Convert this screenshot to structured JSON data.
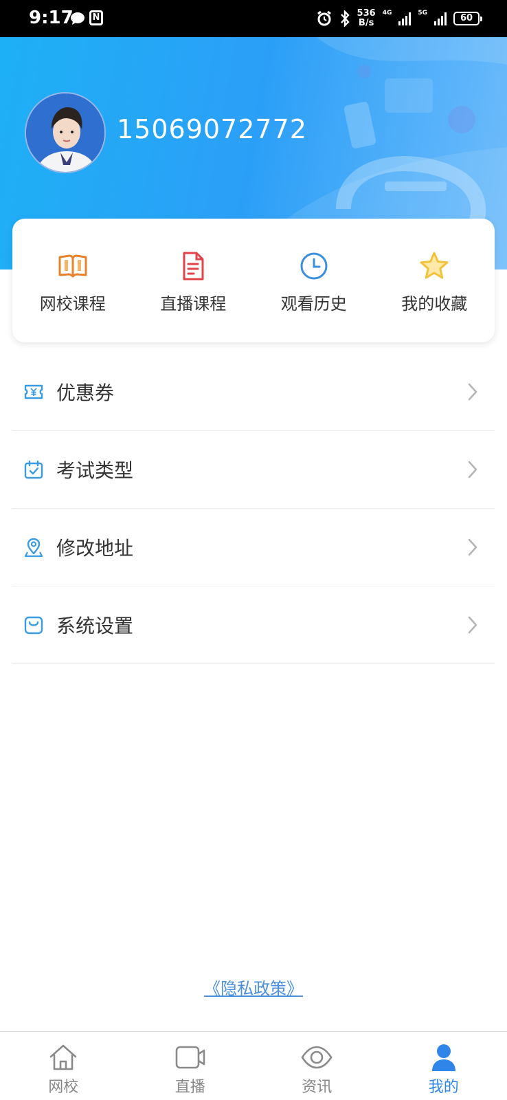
{
  "status_bar": {
    "time": "9:17",
    "speed_value": "536",
    "speed_unit": "B/s",
    "net1": "4G",
    "net2": "5G",
    "battery": "60"
  },
  "profile": {
    "phone": "15069072772",
    "avatar_icon": "avatar-photo"
  },
  "quick_actions": [
    {
      "label": "网校课程",
      "icon": "open-book-icon",
      "color": "#e8832a"
    },
    {
      "label": "直播课程",
      "icon": "document-icon",
      "color": "#e0434a"
    },
    {
      "label": "观看历史",
      "icon": "clock-icon",
      "color": "#3a8fde"
    },
    {
      "label": "我的收藏",
      "icon": "star-icon",
      "color": "#f2c33a"
    }
  ],
  "menu": [
    {
      "label": "优惠券",
      "icon": "coupon-icon"
    },
    {
      "label": "考试类型",
      "icon": "calendar-check-icon"
    },
    {
      "label": "修改地址",
      "icon": "location-pin-icon"
    },
    {
      "label": "系统设置",
      "icon": "bag-icon"
    }
  ],
  "privacy_link": "《隐私政策》",
  "tabs": [
    {
      "label": "网校",
      "icon": "home-icon",
      "active": false
    },
    {
      "label": "直播",
      "icon": "video-camera-icon",
      "active": false
    },
    {
      "label": "资讯",
      "icon": "eye-icon",
      "active": false
    },
    {
      "label": "我的",
      "icon": "person-icon",
      "active": true
    }
  ],
  "colors": {
    "accent": "#2f86e8",
    "header_start": "#1eb0f6",
    "header_end": "#6fbcfb",
    "menu_icon": "#3a9be0"
  }
}
